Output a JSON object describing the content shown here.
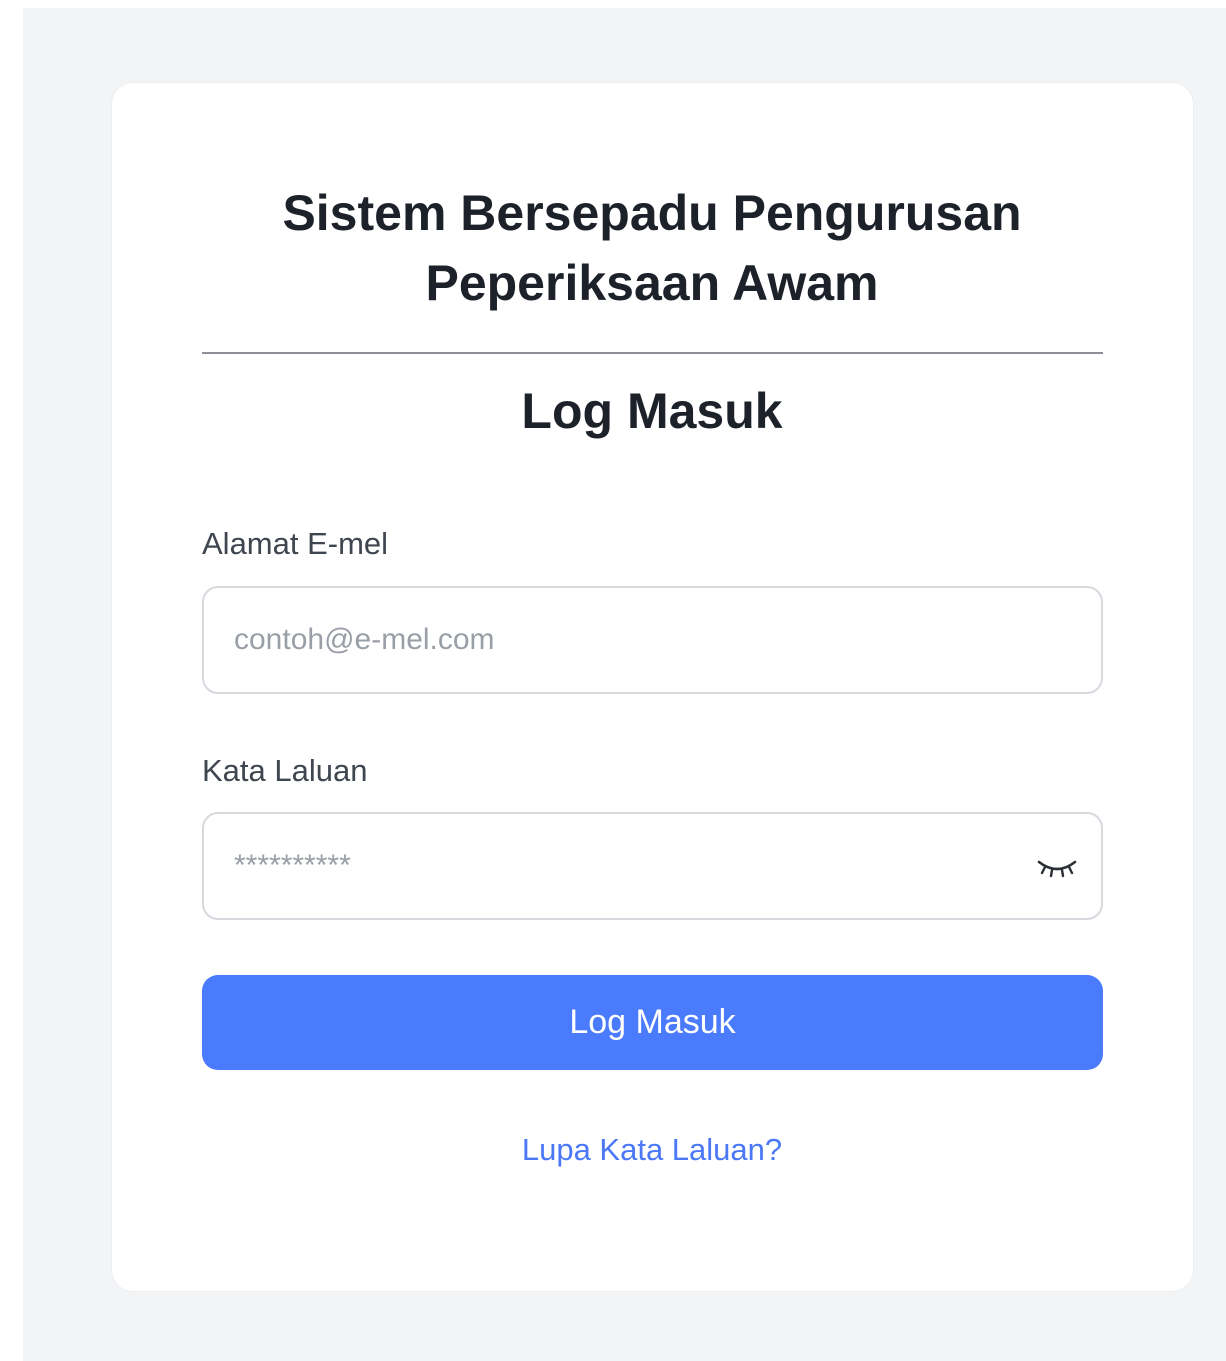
{
  "header": {
    "system_title": "Sistem Bersepadu Pengurusan\nPeperiksaan Awam",
    "login_heading": "Log Masuk"
  },
  "form": {
    "email": {
      "label": "Alamat E-mel",
      "placeholder": "contoh@e-mel.com",
      "value": ""
    },
    "password": {
      "label": "Kata Laluan",
      "placeholder": "**********",
      "value": "",
      "toggle_icon": "eye-closed-icon"
    },
    "submit_label": "Log Masuk",
    "forgot_password_label": "Lupa Kata Laluan?"
  },
  "colors": {
    "accent": "#4b7bfd",
    "link": "#4a78f7",
    "background": "#f3f4f6",
    "card": "#ffffff",
    "heading": "#1d2129"
  }
}
